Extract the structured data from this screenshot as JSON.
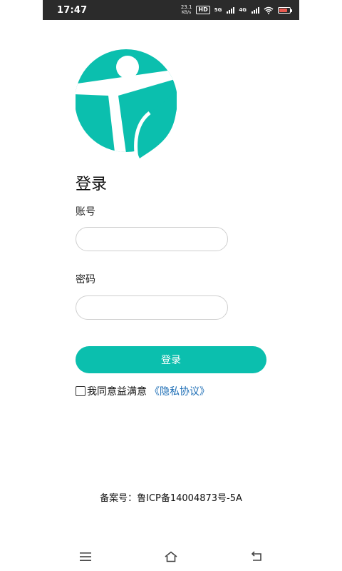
{
  "status_bar": {
    "time": "17:47",
    "net_speed": "23.1",
    "net_speed_unit": "KB/s",
    "hd_label": "HD",
    "network_5g": "5G",
    "network_4g": "4G",
    "battery_color": "#e85a50"
  },
  "login": {
    "title": "登录",
    "account_label": "账号",
    "account_value": "",
    "account_placeholder": "",
    "password_label": "密码",
    "password_value": "",
    "password_placeholder": "",
    "submit_label": "登录",
    "agreement_checked": false,
    "agreement_text": "我同意益满意",
    "privacy_link_text": "《隐私协议》"
  },
  "footer": {
    "icp_text": "备案号：鲁ICP备14004873号-5A"
  },
  "colors": {
    "accent": "#0bbfae",
    "link": "#1f6fb6"
  },
  "nav_bar": {
    "icons": [
      "menu-icon",
      "home-icon",
      "back-icon"
    ]
  }
}
